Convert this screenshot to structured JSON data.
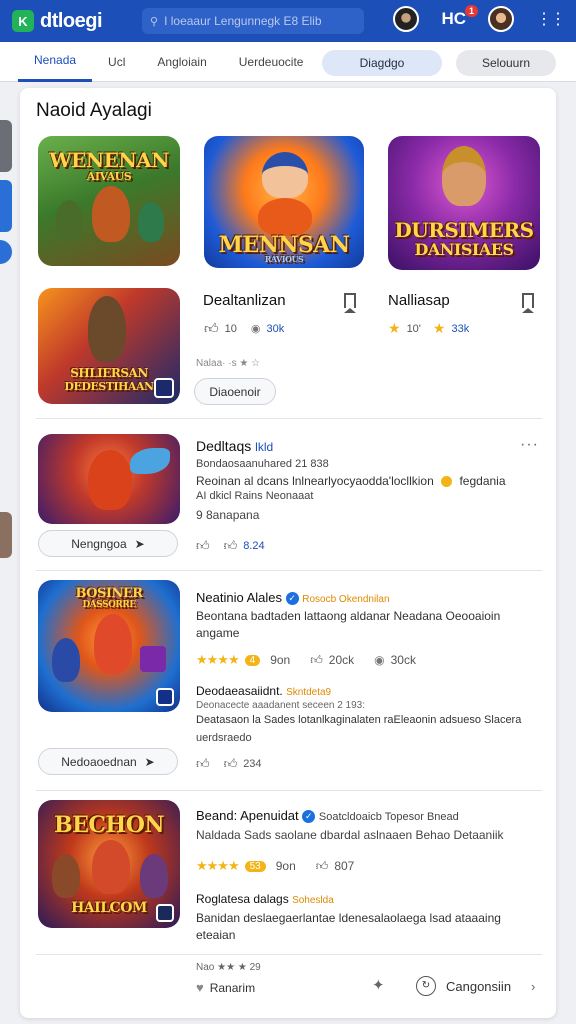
{
  "app": {
    "logo_letter": "K",
    "name": "dtloegi"
  },
  "search": {
    "text": "I loeaaur Lengunnegk E8 Elib"
  },
  "topbar": {
    "badge_text": "HC",
    "badge_count": "1"
  },
  "tabs": [
    "Nenada",
    "Ucl",
    "Angloiain",
    "Uerdeuocite"
  ],
  "pills": {
    "blue": "Diagdgo",
    "gray": "Selouurn"
  },
  "card_title": "Naoid Ayalagi",
  "tiles": {
    "t1": "WENENAN",
    "t1_sub": "AIVAUS",
    "t2": "MENNSAN",
    "t2_sub": "RAVIOUS",
    "t3": "DURSIMERS",
    "t3_sub": "DANISIAES",
    "t4": "SHLIERSAN",
    "t4_sub": "DEDESTIHAAN",
    "t5_caption": "",
    "t6": "BOSINER",
    "t6_sub": "DASSORRE",
    "t7": "BECHON",
    "t7_sub": "HAILCOM"
  },
  "grid_items": [
    {
      "title": "Dealtanlizan",
      "likes": "10",
      "count": "30k"
    },
    {
      "title": "Nalliasap",
      "likes": "10'",
      "count": "33k"
    }
  ],
  "grid_meta": "Nalaa· ·s ★ ☆",
  "grid_button": "Diaoenoir",
  "posts": [
    {
      "title": "Dedltaqs",
      "title_tag": "lkld",
      "line1": "Bondaosaanuhared 21 838",
      "line2": "Reoinan al dcans lnlnearlyocyaodda'locllkion",
      "line2_tail": "fegdania",
      "line3": "AI dkicl Rains Neonaaat",
      "line4": "9 8anapana",
      "likes": "",
      "shares": "8.24",
      "button": "Nengngoa"
    },
    {
      "title": "Neatinio Alales",
      "tag": "Rosocb Okendnilan",
      "body": "Beontana badtaden lattaong aldanar Neadana Oeooaioin angame",
      "rating_badge": "4",
      "stat1": "9on",
      "stat2": "20ck",
      "stat3": "30ck",
      "sub_title": "Deodaeasaiidnt.",
      "sub_tag": "Skntdeta9",
      "sub_line": "Deonacecte aaadanent seceen 2 193:",
      "sub_body": "Deatasaon la Sades lotanlkaginalaten raEleaonin adsueso Slacera",
      "sub_link": "uerdsraedo",
      "shares": "234",
      "button": "Nedoaoednan"
    },
    {
      "title": "Beand: Apenuidat",
      "tag": "Soatcldoaicb Topesor Bnead",
      "line_link": "Naldada Sads saolane dbardal aslnaaen Behao Detaaniik",
      "rating_badge": "53",
      "stat1": "9on",
      "stat2": "807",
      "sub_title": "Roglatesa dalags",
      "sub_tag": "Soheslda",
      "sub_body": "Banidan deslaegaerlantae ldenesalaolaega lsad ataaaing eteaian"
    }
  ],
  "footer": {
    "meta": "Nao ★★ ★ 29",
    "left_label": "Ranarim",
    "right_label": "Cangonsiin"
  }
}
